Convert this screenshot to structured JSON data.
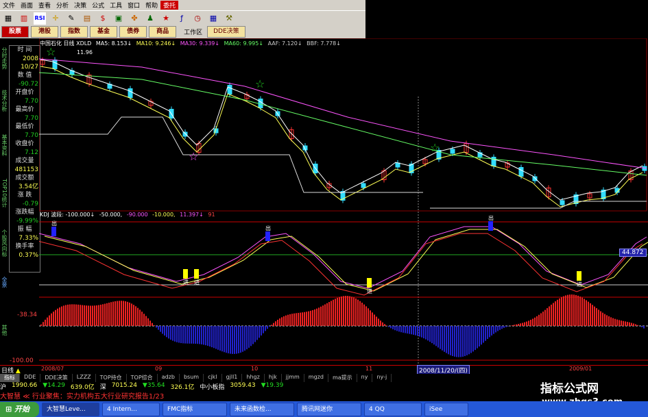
{
  "menu": [
    "文件",
    "画面",
    "查看",
    "分析",
    "决策",
    "公式",
    "工具",
    "窗口",
    "帮助",
    "委托"
  ],
  "toolbar_icons": [
    "grid-icon",
    "chart-icon",
    "rsi-icon",
    "crosshair-icon",
    "pencil-icon",
    "abacus-icon",
    "stock-icon",
    "chart-book-icon",
    "puzzle-icon",
    "people-icon",
    "star-icon",
    "formula-icon",
    "clock-icon",
    "table-icon",
    "tools-icon"
  ],
  "toolbar_rsi": "RSI",
  "tabs": [
    "股票",
    "港股",
    "指数",
    "基金",
    "债券",
    "商品"
  ],
  "workspace_label": "工作区",
  "dde_button": "DDE决策",
  "vertical_tabs": [
    "分时走势",
    "技术分析",
    "基本资料",
    "TOP10统计",
    "个股风向标",
    "全景",
    "其他"
  ],
  "info_panel": {
    "time_label": "时 间",
    "time_val1": "2008",
    "time_val2": "10/27",
    "num_label": "数 值",
    "num_val": "-90.72",
    "open_label": "开盘价",
    "open_val": "7.70",
    "high_label": "最高价",
    "high_val": "7.70",
    "low_label": "最低价",
    "low_val": "7.70",
    "close_label": "收盘价",
    "close_val": "7.12",
    "vol_label": "成交量",
    "vol_val": "481153",
    "amt_label": "成交额",
    "amt_val": "3.54亿",
    "chg_label": "涨 跌",
    "chg_val": "-0.79",
    "pct_label": "涨跌幅",
    "pct_val": "-9.99%",
    "amp_label": "振 幅",
    "amp_val": "7.33%",
    "turn_label": "换手率",
    "turn_val": "0.37%"
  },
  "chart_header": [
    "中国石化 日线 XDLD",
    "MA5: 8.153↓",
    "MA10: 9.246↓",
    "MA30: 9.339↓",
    "MA60: 9.995↓",
    "AAF: 7.120↓",
    "BBF: 7.778↓"
  ],
  "price_label_high": "11.96",
  "sub_header": [
    "KDJ 波段: -100.000↓",
    "-50.000,",
    "-90.000",
    "-10.000,",
    "11.397↓",
    "91"
  ],
  "right_value_tag": "44.872",
  "left_value_tag": "-38.34",
  "axis_neg100": "-100.00",
  "out_marker": "出",
  "in_marker": "进",
  "date_axis": [
    "2008/07",
    "09",
    "10",
    "11",
    "2009/01"
  ],
  "date_box": "2008/11/20/(四)",
  "timeframe_label": "日线",
  "bottom_tabs": [
    "指标",
    "DDE",
    "DDE决策",
    "LZZZ",
    "TOP持仓",
    "TOP综合",
    "adzb",
    "bsum",
    "cjkl",
    "gjll1",
    "hhgz",
    "hjk",
    "jjmm",
    "mgzd",
    "ma提示",
    "ny",
    "ny-j"
  ],
  "quote": {
    "sh_label": "沪",
    "sh_val": "1990.66",
    "sh_chg": "▼14.29",
    "sh_amt": "639.0亿",
    "sz_label": "深",
    "sz_val": "7015.24",
    "sz_chg": "▼35.64",
    "sz_amt": "326.1亿",
    "zx_label": "中小板指",
    "zx_val": "3059.43",
    "zx_chg": "▼19.39"
  },
  "news": "大智慧 ≪ 行业聚焦：实力机构五大行业研究报告1/23",
  "taskbar": {
    "start": "开始",
    "items": [
      "大智慧Leve...",
      "4 Intern...",
      "FMC指标",
      "未来函数检...",
      "腾讯网迷你",
      "4 QQ",
      "iSee"
    ]
  },
  "watermark_line1": "指标公式网",
  "watermark_line2": "www.zbgs3.com",
  "colors": {
    "menu_bg": "#d4d0c8",
    "up": "#ff3333",
    "down": "#33ddff",
    "ma5": "#ffffff",
    "ma10": "#ffff55",
    "ma30": "#ff55ff",
    "ma60": "#66ff66",
    "taskbar": "#2458d8"
  }
}
